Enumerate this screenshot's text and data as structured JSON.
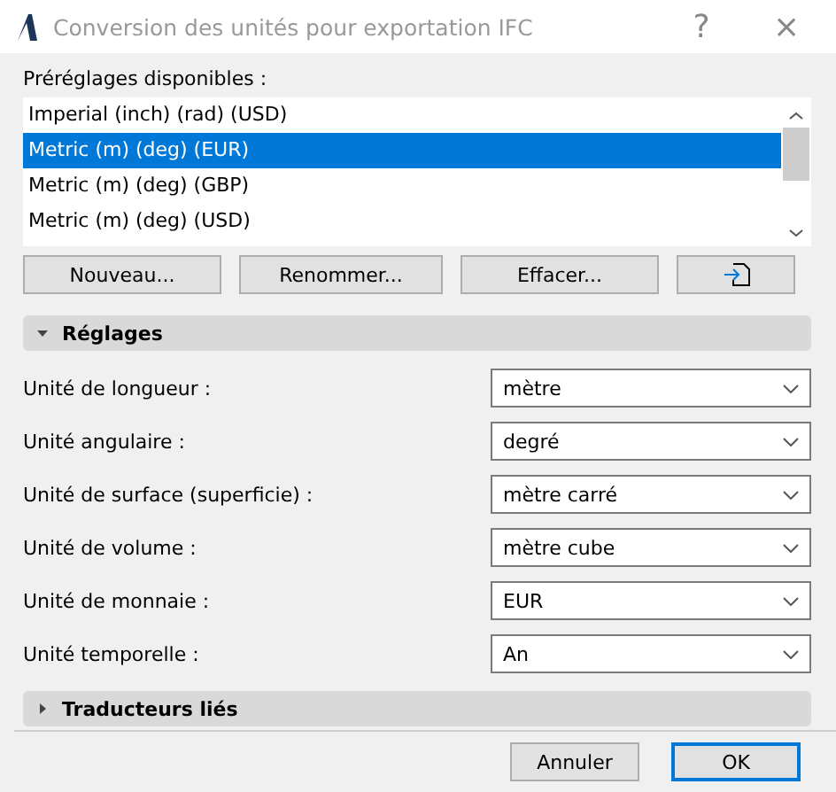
{
  "window": {
    "title": "Conversion des unités pour exportation IFC",
    "help": "?",
    "close": "×"
  },
  "presets": {
    "label": "Préréglages disponibles :",
    "items": [
      {
        "label": "Imperial (inch) (rad) (USD)",
        "selected": false
      },
      {
        "label": "Metric (m) (deg) (EUR)",
        "selected": true
      },
      {
        "label": "Metric (m) (deg) (GBP)",
        "selected": false
      },
      {
        "label": "Metric (m) (deg) (USD)",
        "selected": false
      }
    ]
  },
  "preset_buttons": [
    "Nouveau...",
    "Renommer...",
    "Effacer..."
  ],
  "sections": [
    {
      "title": "Réglages",
      "expanded": true,
      "fields": [
        {
          "label": "Unité de longueur :",
          "value": "mètre"
        },
        {
          "label": "Unité angulaire :",
          "value": "degré"
        },
        {
          "label": "Unité de surface (superficie) :",
          "value": "mètre carré"
        },
        {
          "label": "Unité de volume :",
          "value": "mètre cube"
        },
        {
          "label": "Unité de monnaie :",
          "value": "EUR"
        },
        {
          "label": "Unité temporelle :",
          "value": "An"
        }
      ]
    },
    {
      "title": "Traducteurs liés",
      "expanded": false
    }
  ],
  "buttons": [
    {
      "label": "Annuler",
      "default": false
    },
    {
      "label": "OK",
      "default": true
    }
  ]
}
